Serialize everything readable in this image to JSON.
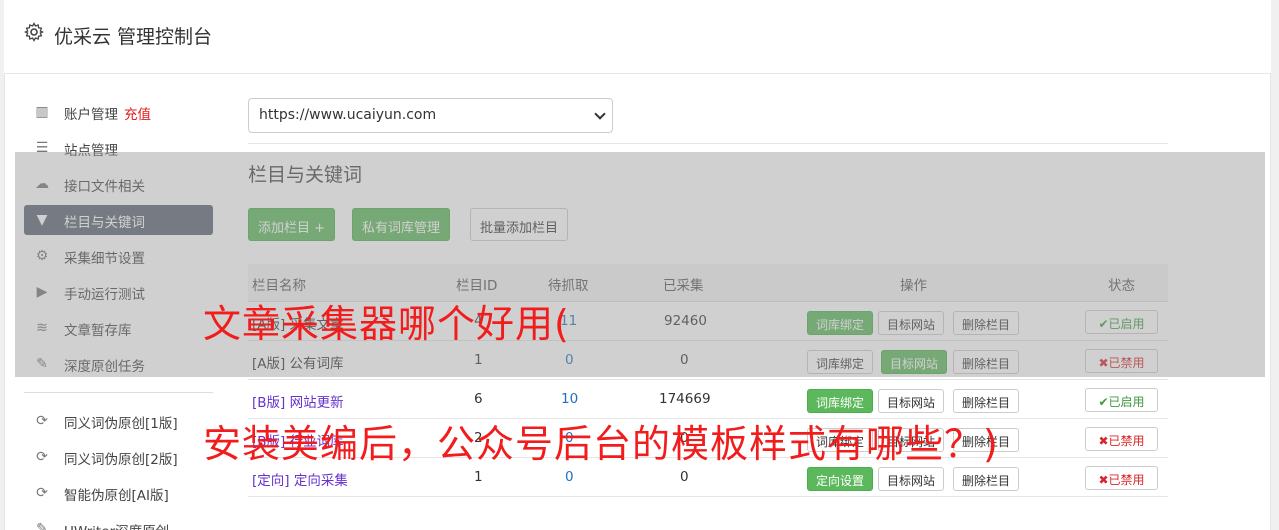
{
  "app": {
    "title": "优采云 管理控制台"
  },
  "sidebar": {
    "items": [
      {
        "label": "账户管理",
        "extra": "充值",
        "icon": "bar-chart-icon"
      },
      {
        "label": "站点管理",
        "icon": "server-icon"
      },
      {
        "label": "接口文件相关",
        "icon": "cloud-upload-icon"
      },
      {
        "label": "栏目与关键词",
        "icon": "filter-icon"
      },
      {
        "label": "采集细节设置",
        "icon": "cogs-icon"
      },
      {
        "label": "手动运行测试",
        "icon": "play-circle-icon"
      },
      {
        "label": "文章暂存库",
        "icon": "database-icon"
      },
      {
        "label": "深度原创任务",
        "icon": "edit-icon"
      },
      {
        "label": "同义词伪原创[1版]",
        "icon": "refresh-icon"
      },
      {
        "label": "同义词伪原创[2版]",
        "icon": "refresh-icon"
      },
      {
        "label": "智能伪原创[AI版]",
        "icon": "refresh-icon"
      },
      {
        "label": "UWriter深度原创",
        "icon": "edit-icon"
      }
    ],
    "active_index": 3
  },
  "site_select": {
    "value": "https://www.ucaiyun.com"
  },
  "section": {
    "title": "栏目与关键词",
    "add_button": "添加栏目 +",
    "private_lib_button": "私有词库管理",
    "batch_add_button": "批量添加栏目"
  },
  "table": {
    "headers": [
      "栏目名称",
      "栏目ID",
      "待抓取",
      "已采集",
      "操作",
      "状态"
    ],
    "rows": [
      {
        "name": "[A版] 采集文章",
        "id": "4",
        "pending": "11",
        "collected": "92460",
        "op1": "词库绑定",
        "op2": "目标网站",
        "op3": "删除栏目",
        "status": "✔已启用"
      },
      {
        "name": "[A版] 公有词库",
        "id": "1",
        "pending": "0",
        "collected": "0",
        "op1": "词库绑定",
        "op2": "目标网站",
        "op3": "删除栏目",
        "status": "✖已禁用"
      },
      {
        "name": "[B版] 网站更新",
        "id": "6",
        "pending": "10",
        "collected": "174669",
        "op1": "词库绑定",
        "op2": "目标网站",
        "op3": "删除栏目",
        "status": "✔已启用"
      },
      {
        "name": "[B版] 行业词库",
        "id": "2",
        "pending": "0",
        "collected": "0",
        "op1": "词库绑定",
        "op2": "目标网站",
        "op3": "删除栏目",
        "status": "✖已禁用"
      },
      {
        "name": "[定向] 定向采集",
        "id": "1",
        "pending": "0",
        "collected": "0",
        "op1": "定向设置",
        "op2": "目标网站",
        "op3": "删除栏目",
        "status": "✖已禁用"
      }
    ]
  },
  "overlay_text": {
    "line1": "文章采集器哪个好用(",
    "line2": "安装美编后，公众号后台的模板样式有哪些？)"
  },
  "colors": {
    "accent_green": "#5cb85c",
    "active_sidebar": "#5b6473",
    "banner_red": "#f21c1c"
  }
}
